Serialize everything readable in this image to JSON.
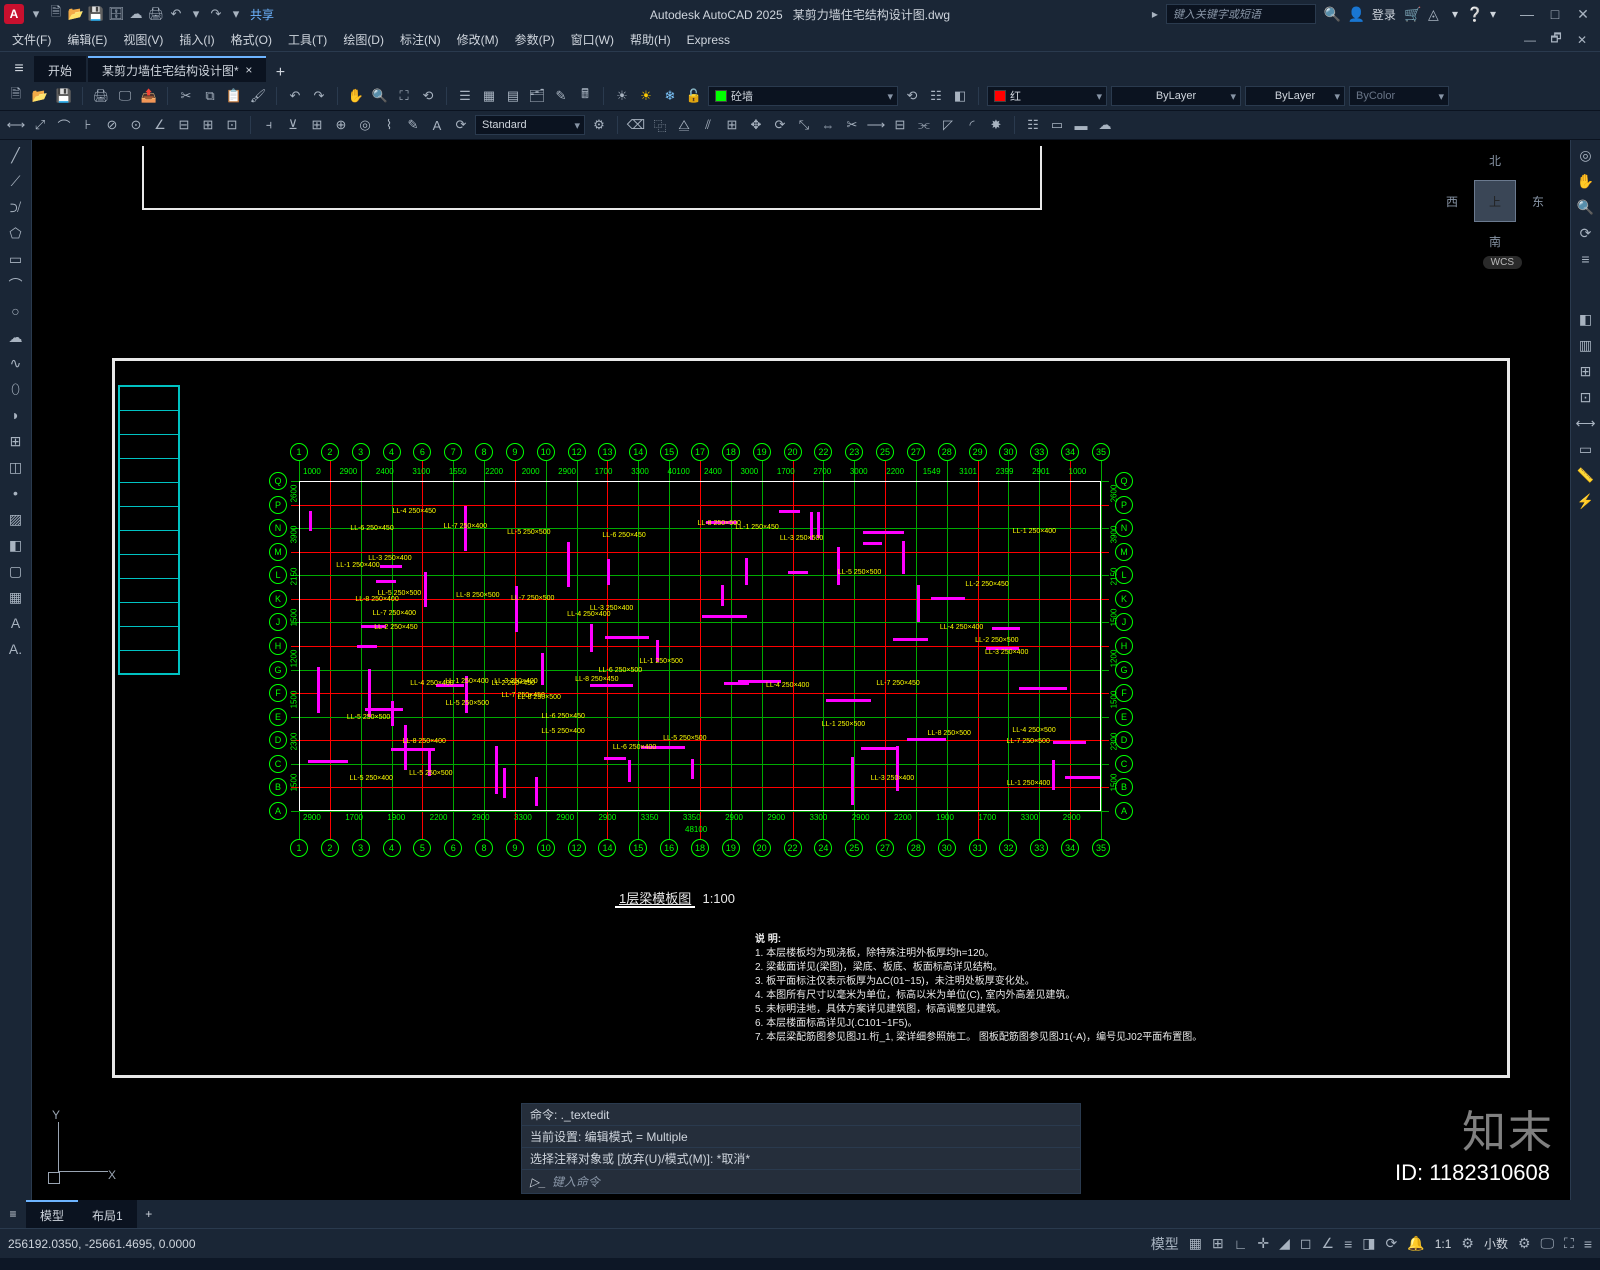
{
  "title": {
    "app": "Autodesk AutoCAD 2025",
    "file": "某剪力墙住宅结构设计图.dwg"
  },
  "searchPlaceholder": "键入关键字或短语",
  "login": "登录",
  "share": "共享",
  "menu": [
    "文件(F)",
    "编辑(E)",
    "视图(V)",
    "插入(I)",
    "格式(O)",
    "工具(T)",
    "绘图(D)",
    "标注(N)",
    "修改(M)",
    "参数(P)",
    "窗口(W)",
    "帮助(H)",
    "Express"
  ],
  "fileTabs": {
    "start": "开始",
    "active": "某剪力墙住宅结构设计图*"
  },
  "layerDD": "砼墙",
  "colorDD": "红",
  "ltDD": "ByLayer",
  "lwDD": "ByLayer",
  "plotDD": "ByColor",
  "styleDD": "Standard",
  "viewcube": {
    "north": "北",
    "south": "南",
    "east": "东",
    "west": "西",
    "top": "上",
    "wcs": "WCS"
  },
  "cmd": {
    "l1": "命令: ._textedit",
    "l2": "当前设置: 编辑模式 = Multiple",
    "l3": "选择注释对象或 [放弃(U)/模式(M)]: *取消*",
    "prompt": "键入命令"
  },
  "bottomTabs": [
    "模型",
    "布局1"
  ],
  "status": {
    "coords": "256192.0350, -25661.4695, 0.0000",
    "snap": "模型",
    "scale": "1:1",
    "dec": "小数"
  },
  "drawing": {
    "title": "1层梁模板图",
    "scale": "1:100",
    "notesTitle": "说 明:",
    "notes": [
      "1. 本层楼板均为现浇板，除特殊注明外板厚均h=120。",
      "2. 梁截面详见(梁图)，梁底、板底、板面标高详见结构。",
      "3. 板平面标注仅表示板厚为ΔC(01~15)，未注明处板厚变化处。",
      "4. 本图所有尺寸以毫米为单位，标高以米为单位(C), 室内外高差见建筑。",
      "5. 未标明洼地，具体方案详见建筑图，标高调整见建筑。",
      "6. 本层楼面标高详见J(.C101~1F5)。",
      "7. 本层梁配筋图参见图J1.桁_1, 梁详细参照施工。  图板配筋图参见图J1(-A)，编号见J02平面布置图。"
    ],
    "colsTop": [
      "1",
      "2",
      "3",
      "4",
      "6",
      "7",
      "8",
      "9",
      "10",
      "12",
      "13",
      "14",
      "15",
      "17",
      "18",
      "19",
      "20",
      "22",
      "23",
      "25",
      "27",
      "28",
      "29",
      "30",
      "33",
      "34",
      "35"
    ],
    "colsBot": [
      "1",
      "2",
      "3",
      "4",
      "5",
      "6",
      "8",
      "9",
      "10",
      "12",
      "14",
      "15",
      "16",
      "18",
      "19",
      "20",
      "22",
      "24",
      "25",
      "27",
      "28",
      "30",
      "31",
      "32",
      "33",
      "34",
      "35"
    ],
    "rows": [
      "Q",
      "P",
      "N",
      "M",
      "L",
      "K",
      "J",
      "H",
      "G",
      "F",
      "E",
      "D",
      "C",
      "B",
      "A"
    ],
    "dimsTop": [
      "1000",
      "2900",
      "2400",
      "3100",
      "1550",
      "2200",
      "2000",
      "2900",
      "1700",
      "3300",
      "40100",
      "2400",
      "3000",
      "1700",
      "2700",
      "3000",
      "2200",
      "1549",
      "3101",
      "2399",
      "2901",
      "1000"
    ],
    "totalBot": "48100",
    "dimsBot": [
      "2900",
      "1700",
      "1900",
      "2200",
      "2900",
      "3300",
      "2900",
      "2900",
      "3350",
      "3350",
      "2900",
      "2900",
      "3300",
      "2900",
      "2200",
      "1900",
      "1700",
      "3300",
      "2900"
    ],
    "dimsSide": [
      "2600",
      "3900",
      "2150",
      "1500",
      "1200",
      "1500",
      "2300",
      "1500"
    ]
  },
  "watermark": "知末",
  "imageId": "ID: 1182310608"
}
